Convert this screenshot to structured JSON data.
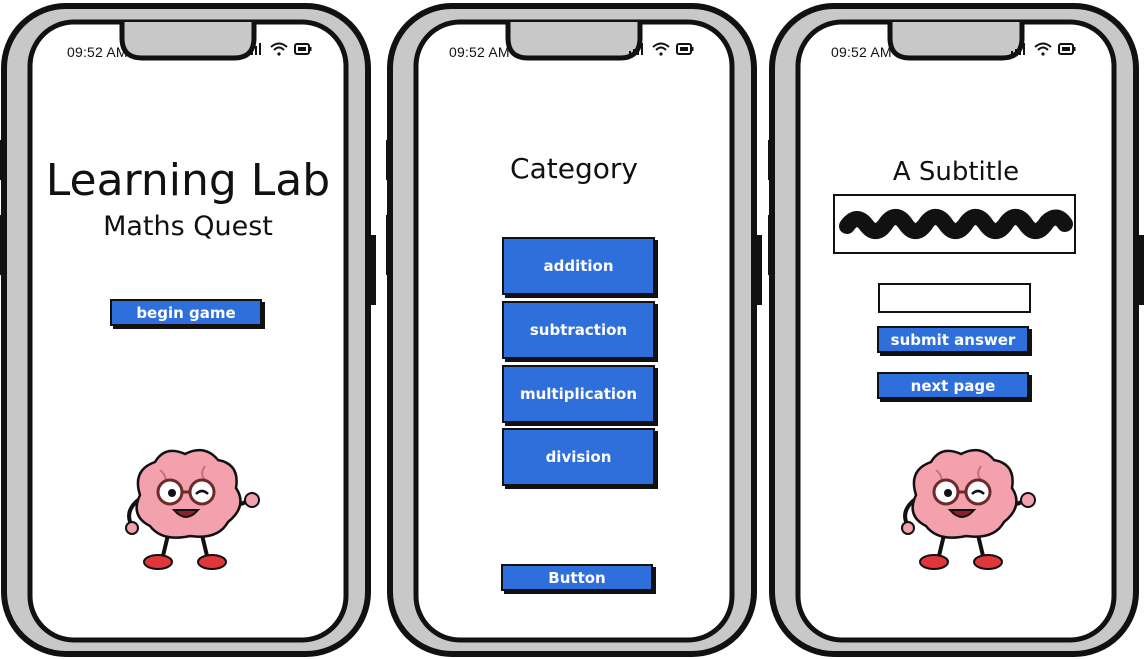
{
  "status_bar": {
    "time": "09:52 AM"
  },
  "screens": [
    {
      "title": "Learning Lab",
      "subtitle": "Maths Quest",
      "begin_label": "begin game",
      "mascot_icon": "brain-mascot-icon"
    },
    {
      "title": "Category",
      "categories": [
        {
          "label": "addition"
        },
        {
          "label": "subtraction"
        },
        {
          "label": "multiplication"
        },
        {
          "label": "division"
        }
      ],
      "bottom_button_label": "Button"
    },
    {
      "title": "A Subtitle",
      "answer_value": "",
      "submit_label": "submit answer",
      "next_label": "next page",
      "mascot_icon": "brain-mascot-icon"
    }
  ],
  "colors": {
    "button": "#2f6fdc",
    "frame_outer": "#c8c8c8",
    "ink": "#111111",
    "brain": "#f2a1ad",
    "shoe": "#e0353a"
  }
}
